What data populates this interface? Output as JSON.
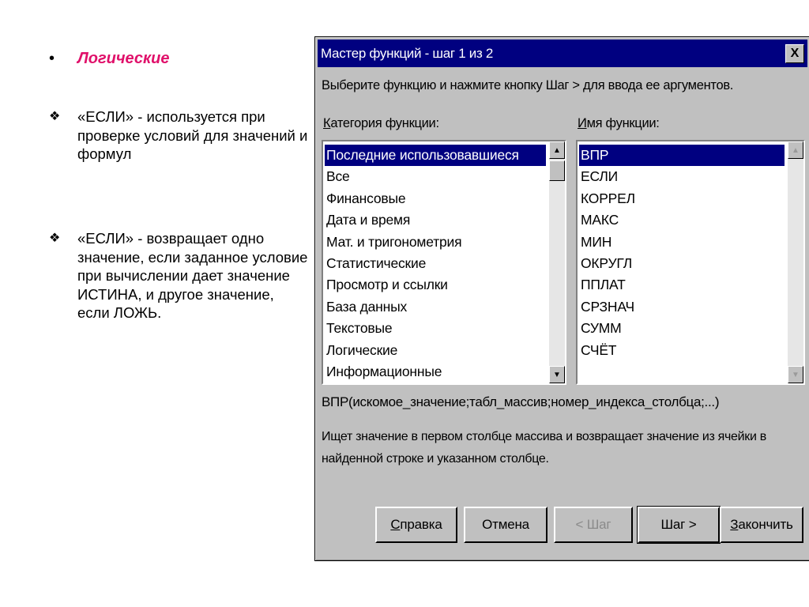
{
  "slide": {
    "heading_bullet": "•",
    "heading": "Логические",
    "paragraphs": [
      {
        "marker": "❖",
        "text": "«ЕСЛИ» -  используется при проверке условий для значений и формул"
      },
      {
        "marker": "❖",
        "text": "«ЕСЛИ» - возвращает одно значение, если заданное условие при вычислении дает значение ИСТИНА, и другое значение, если ЛОЖЬ."
      }
    ]
  },
  "dialog": {
    "title": "Мастер функций - шаг 1 из 2",
    "close_label": "X",
    "instruction": "Выберите функцию и нажмите кнопку Шаг > для ввода ее аргументов.",
    "category_label": "Категория функции:",
    "category_label_key": "К",
    "category_label_rest": "атегория функции:",
    "name_label_key": "И",
    "name_label_rest": "мя функции:",
    "categories": [
      "Последние использовавшиеся",
      "Все",
      "Финансовые",
      "Дата и время",
      "Мат. и тригонометрия",
      "Статистические",
      "Просмотр и ссылки",
      "База данных",
      "Текстовые",
      "Логические",
      "Информационные"
    ],
    "selected_category": "Последние использовавшиеся",
    "functions": [
      "ВПР",
      "ЕСЛИ",
      "КОРРЕЛ",
      "МАКС",
      "МИН",
      "ОКРУГЛ",
      "ППЛАТ",
      "СРЗНАЧ",
      "СУММ",
      "СЧЁТ"
    ],
    "selected_function": "ВПР",
    "syntax": "ВПР(искомое_значение;табл_массив;номер_индекса_столбца;...)",
    "description_line1": "Ищет значение в первом столбце массива и возвращает значение из ячейки в",
    "description_line2": "найденной строке и указанном столбце.",
    "buttons": {
      "help_key": "С",
      "help_rest": "правка",
      "cancel": "Отмена",
      "back": "< Шаг",
      "next": "Шаг >",
      "finish_key": "З",
      "finish_rest": "акончить"
    }
  }
}
